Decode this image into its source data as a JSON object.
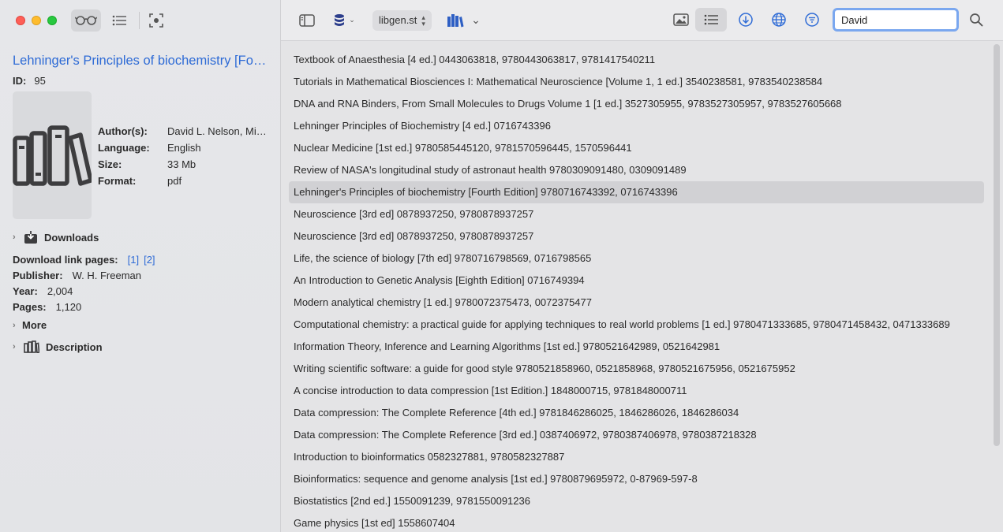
{
  "sidebar": {
    "title": "Lehninger's Principles of biochemistry [Fourth Edition]",
    "id_label": "ID:",
    "id_value": "95",
    "meta": [
      {
        "key": "Author(s):",
        "value": "David L. Nelson, Michael M. Cox"
      },
      {
        "key": "Language:",
        "value": "English"
      },
      {
        "key": "Size:",
        "value": "33 Mb"
      },
      {
        "key": "Format:",
        "value": "pdf"
      }
    ],
    "downloads_label": "Downloads",
    "download_pages_label": "Download link pages:",
    "download_links": [
      "[1]",
      "[2]"
    ],
    "publisher_label": "Publisher:",
    "publisher_value": "W. H. Freeman",
    "year_label": "Year:",
    "year_value": "2,004",
    "pages_label": "Pages:",
    "pages_value": "1,120",
    "more_label": "More",
    "description_label": "Description"
  },
  "toolbar": {
    "source": "libgen.st",
    "search_value": "David"
  },
  "results": [
    "Textbook of Anaesthesia [4 ed.] 0443063818, 9780443063817, 9781417540211",
    "Tutorials in Mathematical Biosciences I: Mathematical Neuroscience [Volume 1, 1 ed.] 3540238581, 9783540238584",
    "DNA and RNA Binders, From Small Molecules to Drugs Volume 1 [1 ed.] 3527305955, 9783527305957, 9783527605668",
    "Lehninger Principles of Biochemistry [4 ed.] 0716743396",
    "Nuclear Medicine [1st ed.] 9780585445120, 9781570596445, 1570596441",
    "Review of NASA's longitudinal study of astronaut health 9780309091480, 0309091489",
    "Lehninger's Principles of biochemistry [Fourth Edition] 9780716743392, 0716743396",
    "Neuroscience [3rd ed] 0878937250, 9780878937257",
    "Neuroscience [3rd ed] 0878937250, 9780878937257",
    "Life, the science of biology [7th ed] 9780716798569, 0716798565",
    "An Introduction to Genetic Analysis [Eighth Edition] 0716749394",
    "Modern analytical chemistry [1 ed.] 9780072375473, 0072375477",
    "Computational chemistry: a practical guide for applying techniques to real world problems [1 ed.] 9780471333685, 9780471458432, 0471333689",
    "Information Theory, Inference and Learning Algorithms [1st ed.] 9780521642989, 0521642981",
    "Writing scientific software: a guide for good style 9780521858960, 0521858968, 9780521675956, 0521675952",
    "A concise introduction to data compression [1st Edition.] 1848000715, 9781848000711",
    "Data compression: The Complete Reference [4th ed.] 9781846286025, 1846286026, 1846286034",
    "Data compression: The Complete Reference [3rd ed.] 0387406972, 9780387406978, 9780387218328",
    "Introduction to bioinformatics 0582327881, 9780582327887",
    "Bioinformatics: sequence and genome analysis [1st ed.] 9780879695972, 0-87969-597-8",
    "Biostatistics [2nd ed.] 1550091239, 9781550091236",
    "Game physics [1st ed] 1558607404"
  ],
  "selected_index": 6
}
